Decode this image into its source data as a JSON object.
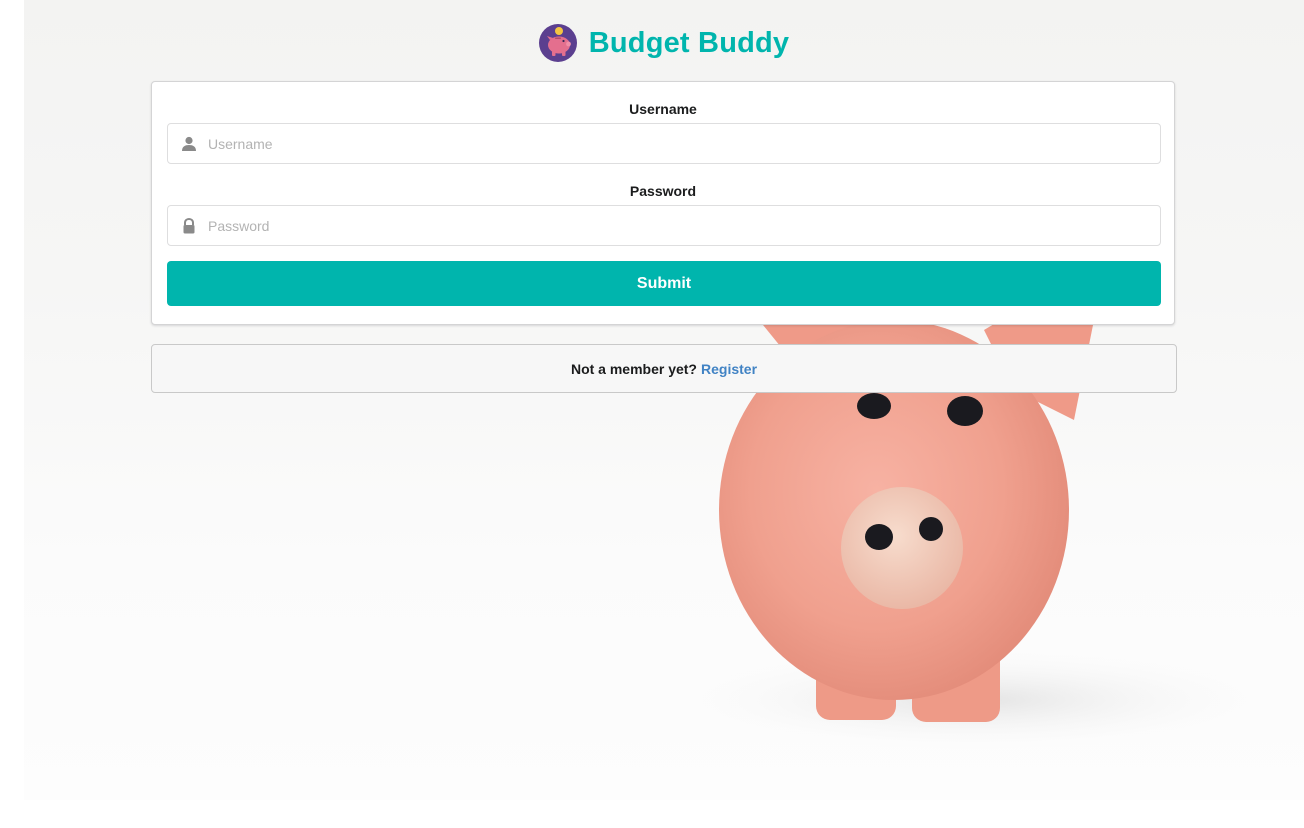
{
  "app": {
    "title": "Budget Buddy",
    "logo_icon": "piggy-bank-icon"
  },
  "login_form": {
    "username": {
      "label": "Username",
      "placeholder": "Username",
      "value": "",
      "icon": "user-icon"
    },
    "password": {
      "label": "Password",
      "placeholder": "Password",
      "value": "",
      "icon": "lock-icon"
    },
    "submit_label": "Submit"
  },
  "register": {
    "prompt": "Not a member yet?",
    "link_label": "Register"
  },
  "colors": {
    "accent": "#00b5ad",
    "link": "#4183c4",
    "logo_circle": "#5b3f8f",
    "logo_pig": "#e46f8e",
    "coin": "#f4c542",
    "pig_body": "#f2a292"
  }
}
